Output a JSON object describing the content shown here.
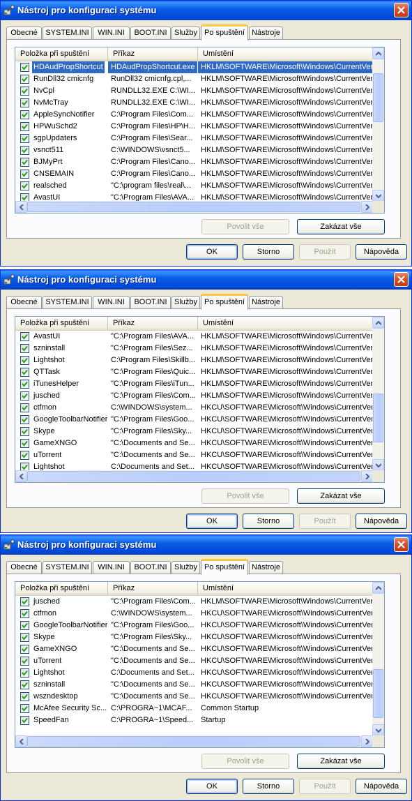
{
  "title": "Nástroj pro konfiguraci systému",
  "tabs": [
    "Obecné",
    "SYSTEM.INI",
    "WIN.INI",
    "BOOT.INI",
    "Služby",
    "Po spuštění",
    "Nástroje"
  ],
  "active_tab": "Po spuštění",
  "columns": {
    "name": "Položka při spuštění",
    "command": "Příkaz",
    "location": "Umístění"
  },
  "buttons": {
    "enable_all": "Povolit vše",
    "disable_all": "Zakázat vše",
    "ok": "OK",
    "cancel": "Storno",
    "apply": "Použít",
    "help": "Nápověda"
  },
  "icons": {
    "title": "msconfig-icon",
    "close": "close-icon",
    "checkbox": "checkmark-icon"
  },
  "colors": {
    "titlebar": "#0a5fe6",
    "selection": "#316ac5",
    "active_tab_accent": "#ffc83c"
  },
  "windows": [
    {
      "rows": [
        {
          "name": "HDAudPropShortcut",
          "command": "HDAudPropShortcut.exe",
          "location": "HKLM\\SOFTWARE\\Microsoft\\Windows\\CurrentVer...",
          "checked": true,
          "selected": true
        },
        {
          "name": "RunDll32 cmicnfg",
          "command": "RunDll32 cmicnfg.cpl,...",
          "location": "HKLM\\SOFTWARE\\Microsoft\\Windows\\CurrentVer...",
          "checked": true
        },
        {
          "name": "NvCpl",
          "command": "RUNDLL32.EXE C:\\WI...",
          "location": "HKLM\\SOFTWARE\\Microsoft\\Windows\\CurrentVer...",
          "checked": true
        },
        {
          "name": "NvMcTray",
          "command": "RUNDLL32.EXE C:\\WI...",
          "location": "HKLM\\SOFTWARE\\Microsoft\\Windows\\CurrentVer...",
          "checked": true
        },
        {
          "name": "AppleSyncNotifier",
          "command": "C:\\Program Files\\Com...",
          "location": "HKLM\\SOFTWARE\\Microsoft\\Windows\\CurrentVer...",
          "checked": true
        },
        {
          "name": "HPWuSchd2",
          "command": "C:\\Program Files\\HP\\H...",
          "location": "HKLM\\SOFTWARE\\Microsoft\\Windows\\CurrentVer...",
          "checked": true
        },
        {
          "name": "sgpUpdaters",
          "command": "C:\\Program Files\\Sear...",
          "location": "HKLM\\SOFTWARE\\Microsoft\\Windows\\CurrentVer...",
          "checked": true
        },
        {
          "name": "vsnct511",
          "command": "C:\\WINDOWS\\vsnct5...",
          "location": "HKLM\\SOFTWARE\\Microsoft\\Windows\\CurrentVer...",
          "checked": true
        },
        {
          "name": "BJMyPrt",
          "command": "C:\\Program Files\\Cano...",
          "location": "HKLM\\SOFTWARE\\Microsoft\\Windows\\CurrentVer...",
          "checked": true
        },
        {
          "name": "CNSEMAIN",
          "command": "C:\\Program Files\\Cano...",
          "location": "HKLM\\SOFTWARE\\Microsoft\\Windows\\CurrentVer...",
          "checked": true
        },
        {
          "name": "realsched",
          "command": "\"C:\\program files\\real\\...",
          "location": "HKLM\\SOFTWARE\\Microsoft\\Windows\\CurrentVer...",
          "checked": true
        },
        {
          "name": "AvastUI",
          "command": "\"C:\\Program Files\\AVA...",
          "location": "HKLM\\SOFTWARE\\Microsoft\\Windows\\CurrentVer...",
          "checked": true
        }
      ]
    },
    {
      "rows": [
        {
          "name": "AvastUI",
          "command": "\"C:\\Program Files\\AVA...",
          "location": "HKLM\\SOFTWARE\\Microsoft\\Windows\\CurrentVer...",
          "checked": true
        },
        {
          "name": "szninstall",
          "command": "\"C:\\Program Files\\Sez...",
          "location": "HKLM\\SOFTWARE\\Microsoft\\Windows\\CurrentVer...",
          "checked": true
        },
        {
          "name": "Lightshot",
          "command": "C:\\Program Files\\Skillb...",
          "location": "HKLM\\SOFTWARE\\Microsoft\\Windows\\CurrentVer...",
          "checked": true
        },
        {
          "name": "QTTask",
          "command": "\"C:\\Program Files\\Quic...",
          "location": "HKLM\\SOFTWARE\\Microsoft\\Windows\\CurrentVer...",
          "checked": true
        },
        {
          "name": "iTunesHelper",
          "command": "\"C:\\Program Files\\iTun...",
          "location": "HKLM\\SOFTWARE\\Microsoft\\Windows\\CurrentVer...",
          "checked": true
        },
        {
          "name": "jusched",
          "command": "\"C:\\Program Files\\Com...",
          "location": "HKLM\\SOFTWARE\\Microsoft\\Windows\\CurrentVer...",
          "checked": true
        },
        {
          "name": "ctfmon",
          "command": "C:\\WINDOWS\\system...",
          "location": "HKCU\\SOFTWARE\\Microsoft\\Windows\\CurrentVer...",
          "checked": true
        },
        {
          "name": "GoogleToolbarNotifier",
          "command": "\"C:\\Program Files\\Goo...",
          "location": "HKCU\\SOFTWARE\\Microsoft\\Windows\\CurrentVer...",
          "checked": true
        },
        {
          "name": "Skype",
          "command": "\"C:\\Program Files\\Sky...",
          "location": "HKCU\\SOFTWARE\\Microsoft\\Windows\\CurrentVer...",
          "checked": true
        },
        {
          "name": "GameXNGO",
          "command": "\"C:\\Documents and Se...",
          "location": "HKCU\\SOFTWARE\\Microsoft\\Windows\\CurrentVer...",
          "checked": true
        },
        {
          "name": "uTorrent",
          "command": "\"C:\\Documents and Se...",
          "location": "HKCU\\SOFTWARE\\Microsoft\\Windows\\CurrentVer...",
          "checked": true
        },
        {
          "name": "Lightshot",
          "command": "C:\\Documents and Set...",
          "location": "HKCU\\SOFTWARE\\Microsoft\\Windows\\CurrentVer...",
          "checked": true
        }
      ]
    },
    {
      "rows": [
        {
          "name": "jusched",
          "command": "\"C:\\Program Files\\Com...",
          "location": "HKLM\\SOFTWARE\\Microsoft\\Windows\\CurrentVer...",
          "checked": true
        },
        {
          "name": "ctfmon",
          "command": "C:\\WINDOWS\\system...",
          "location": "HKCU\\SOFTWARE\\Microsoft\\Windows\\CurrentVer...",
          "checked": true
        },
        {
          "name": "GoogleToolbarNotifier",
          "command": "\"C:\\Program Files\\Goo...",
          "location": "HKCU\\SOFTWARE\\Microsoft\\Windows\\CurrentVer...",
          "checked": true
        },
        {
          "name": "Skype",
          "command": "\"C:\\Program Files\\Sky...",
          "location": "HKCU\\SOFTWARE\\Microsoft\\Windows\\CurrentVer...",
          "checked": true
        },
        {
          "name": "GameXNGO",
          "command": "\"C:\\Documents and Se...",
          "location": "HKCU\\SOFTWARE\\Microsoft\\Windows\\CurrentVer...",
          "checked": true
        },
        {
          "name": "uTorrent",
          "command": "\"C:\\Documents and Se...",
          "location": "HKCU\\SOFTWARE\\Microsoft\\Windows\\CurrentVer...",
          "checked": true
        },
        {
          "name": "Lightshot",
          "command": "C:\\Documents and Set...",
          "location": "HKCU\\SOFTWARE\\Microsoft\\Windows\\CurrentVer...",
          "checked": true
        },
        {
          "name": "szninstall",
          "command": "\"C:\\Documents and Se...",
          "location": "HKCU\\SOFTWARE\\Microsoft\\Windows\\CurrentVer...",
          "checked": true
        },
        {
          "name": "wszndesktop",
          "command": "\"C:\\Documents and Se...",
          "location": "HKCU\\SOFTWARE\\Microsoft\\Windows\\CurrentVer...",
          "checked": true
        },
        {
          "name": "McAfee Security Sc...",
          "command": "C:\\PROGRA~1\\MCAF...",
          "location": "Common Startup",
          "checked": true
        },
        {
          "name": "SpeedFan",
          "command": "C:\\PROGRA~1\\Speed...",
          "location": "Startup",
          "checked": true
        }
      ]
    }
  ]
}
